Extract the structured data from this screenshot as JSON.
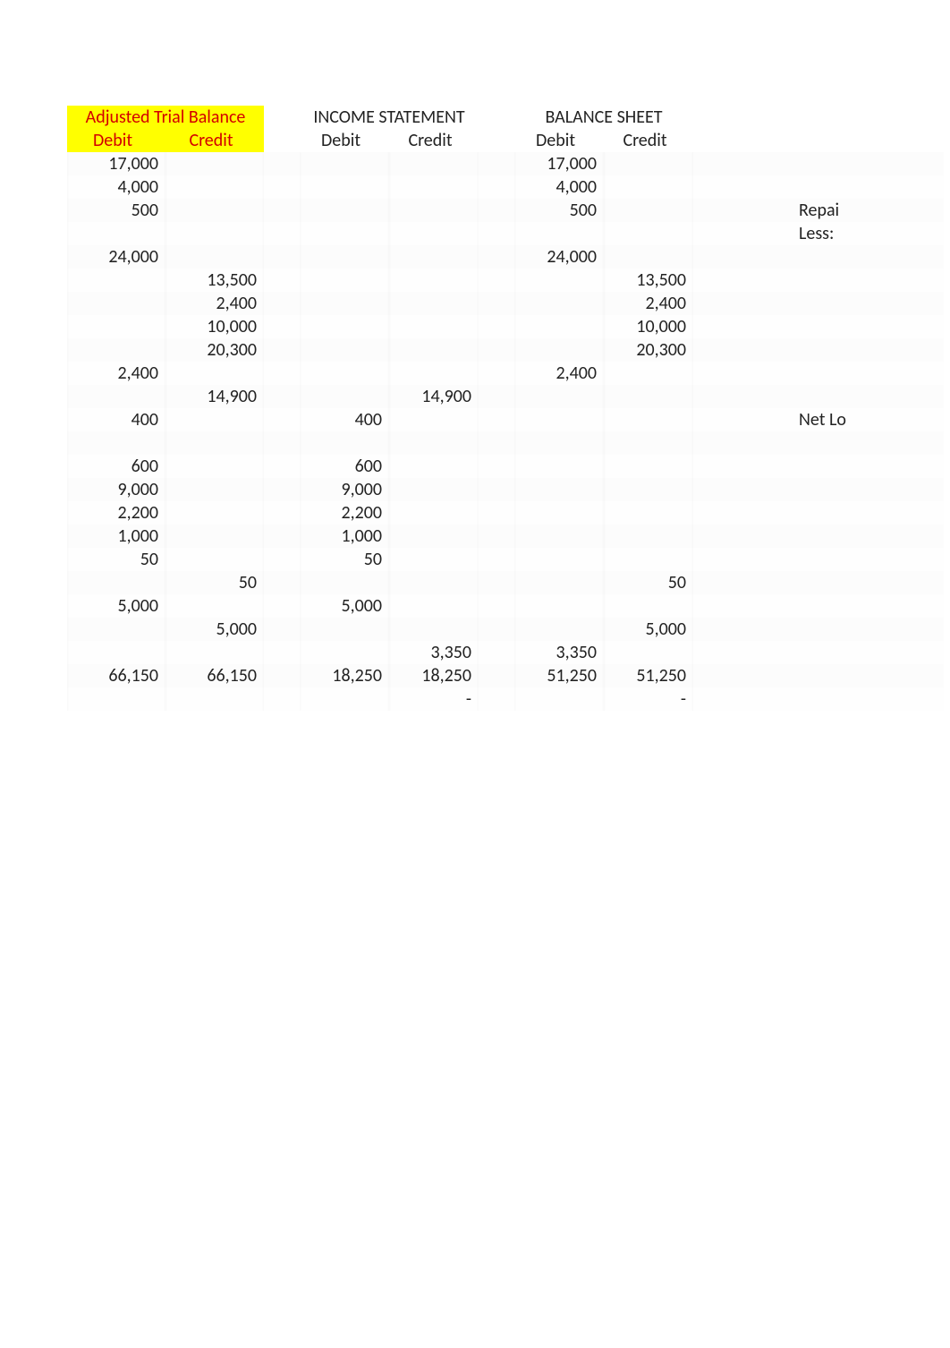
{
  "groups": {
    "atb": {
      "title": "Adjusted Trial Balance",
      "debit": "Debit",
      "credit": "Credit"
    },
    "is": {
      "title": "INCOME STATEMENT",
      "debit": "Debit",
      "credit": "Credit"
    },
    "bs": {
      "title": "BALANCE SHEET",
      "debit": "Debit",
      "credit": "Credit"
    }
  },
  "side_labels": {
    "row2": "Repai",
    "row3": "Less:",
    "row11": "Net Lo"
  },
  "rows": [
    {
      "atb_d": "17,000",
      "atb_c": "",
      "is_d": "",
      "is_c": "",
      "bs_d": "17,000",
      "bs_c": ""
    },
    {
      "atb_d": "4,000",
      "atb_c": "",
      "is_d": "",
      "is_c": "",
      "bs_d": "4,000",
      "bs_c": ""
    },
    {
      "atb_d": "500",
      "atb_c": "",
      "is_d": "",
      "is_c": "",
      "bs_d": "500",
      "bs_c": ""
    },
    {
      "atb_d": "",
      "atb_c": "",
      "is_d": "",
      "is_c": "",
      "bs_d": "",
      "bs_c": ""
    },
    {
      "atb_d": "24,000",
      "atb_c": "",
      "is_d": "",
      "is_c": "",
      "bs_d": "24,000",
      "bs_c": ""
    },
    {
      "atb_d": "",
      "atb_c": "13,500",
      "is_d": "",
      "is_c": "",
      "bs_d": "",
      "bs_c": "13,500"
    },
    {
      "atb_d": "",
      "atb_c": "2,400",
      "is_d": "",
      "is_c": "",
      "bs_d": "",
      "bs_c": "2,400"
    },
    {
      "atb_d": "",
      "atb_c": "10,000",
      "is_d": "",
      "is_c": "",
      "bs_d": "",
      "bs_c": "10,000"
    },
    {
      "atb_d": "",
      "atb_c": "20,300",
      "is_d": "",
      "is_c": "",
      "bs_d": "",
      "bs_c": "20,300"
    },
    {
      "atb_d": "2,400",
      "atb_c": "",
      "is_d": "",
      "is_c": "",
      "bs_d": "2,400",
      "bs_c": ""
    },
    {
      "atb_d": "",
      "atb_c": "14,900",
      "is_d": "",
      "is_c": "14,900",
      "bs_d": "",
      "bs_c": ""
    },
    {
      "atb_d": "400",
      "atb_c": "",
      "is_d": "400",
      "is_c": "",
      "bs_d": "",
      "bs_c": ""
    },
    {
      "atb_d": "",
      "atb_c": "",
      "is_d": "",
      "is_c": "",
      "bs_d": "",
      "bs_c": ""
    },
    {
      "atb_d": "600",
      "atb_c": "",
      "is_d": "600",
      "is_c": "",
      "bs_d": "",
      "bs_c": ""
    },
    {
      "atb_d": "9,000",
      "atb_c": "",
      "is_d": "9,000",
      "is_c": "",
      "bs_d": "",
      "bs_c": ""
    },
    {
      "atb_d": "2,200",
      "atb_c": "",
      "is_d": "2,200",
      "is_c": "",
      "bs_d": "",
      "bs_c": ""
    },
    {
      "atb_d": "1,000",
      "atb_c": "",
      "is_d": "1,000",
      "is_c": "",
      "bs_d": "",
      "bs_c": ""
    },
    {
      "atb_d": "50",
      "atb_c": "",
      "is_d": "50",
      "is_c": "",
      "bs_d": "",
      "bs_c": ""
    },
    {
      "atb_d": "",
      "atb_c": "50",
      "is_d": "",
      "is_c": "",
      "bs_d": "",
      "bs_c": "50"
    },
    {
      "atb_d": "5,000",
      "atb_c": "",
      "is_d": "5,000",
      "is_c": "",
      "bs_d": "",
      "bs_c": ""
    },
    {
      "atb_d": "",
      "atb_c": "5,000",
      "is_d": "",
      "is_c": "",
      "bs_d": "",
      "bs_c": "5,000"
    },
    {
      "atb_d": "",
      "atb_c": "",
      "is_d": "",
      "is_c": "3,350",
      "bs_d": "3,350",
      "bs_c": ""
    },
    {
      "atb_d": "66,150",
      "atb_c": "66,150",
      "is_d": "18,250",
      "is_c": "18,250",
      "bs_d": "51,250",
      "bs_c": "51,250"
    },
    {
      "atb_d": "",
      "atb_c": "",
      "is_d": "",
      "is_c": "-",
      "bs_d": "",
      "bs_c": "-"
    }
  ],
  "chart_data": {
    "type": "table",
    "title": "Worksheet columns",
    "sections": [
      {
        "name": "Adjusted Trial Balance",
        "columns": [
          "Debit",
          "Credit"
        ],
        "totals": [
          66150,
          66150
        ]
      },
      {
        "name": "Income Statement",
        "columns": [
          "Debit",
          "Credit"
        ],
        "totals": [
          18250,
          18250
        ]
      },
      {
        "name": "Balance Sheet",
        "columns": [
          "Debit",
          "Credit"
        ],
        "totals": [
          51250,
          51250
        ]
      }
    ],
    "records": [
      {
        "atb_debit": 17000,
        "bs_debit": 17000
      },
      {
        "atb_debit": 4000,
        "bs_debit": 4000
      },
      {
        "atb_debit": 500,
        "bs_debit": 500
      },
      {},
      {
        "atb_debit": 24000,
        "bs_debit": 24000
      },
      {
        "atb_credit": 13500,
        "bs_credit": 13500
      },
      {
        "atb_credit": 2400,
        "bs_credit": 2400
      },
      {
        "atb_credit": 10000,
        "bs_credit": 10000
      },
      {
        "atb_credit": 20300,
        "bs_credit": 20300
      },
      {
        "atb_debit": 2400,
        "bs_debit": 2400
      },
      {
        "atb_credit": 14900,
        "is_credit": 14900
      },
      {
        "atb_debit": 400,
        "is_debit": 400
      },
      {},
      {
        "atb_debit": 600,
        "is_debit": 600
      },
      {
        "atb_debit": 9000,
        "is_debit": 9000
      },
      {
        "atb_debit": 2200,
        "is_debit": 2200
      },
      {
        "atb_debit": 1000,
        "is_debit": 1000
      },
      {
        "atb_debit": 50,
        "is_debit": 50
      },
      {
        "atb_credit": 50,
        "bs_credit": 50
      },
      {
        "atb_debit": 5000,
        "is_debit": 5000
      },
      {
        "atb_credit": 5000,
        "bs_credit": 5000
      },
      {
        "is_credit": 3350,
        "bs_debit": 3350
      },
      {
        "atb_debit": 66150,
        "atb_credit": 66150,
        "is_debit": 18250,
        "is_credit": 18250,
        "bs_debit": 51250,
        "bs_credit": 51250
      },
      {
        "is_credit": 0,
        "bs_credit": 0
      }
    ],
    "side_annotations": [
      {
        "row_index": 2,
        "text": "Repai"
      },
      {
        "row_index": 3,
        "text": "Less:"
      },
      {
        "row_index": 11,
        "text": "Net Lo"
      }
    ]
  }
}
